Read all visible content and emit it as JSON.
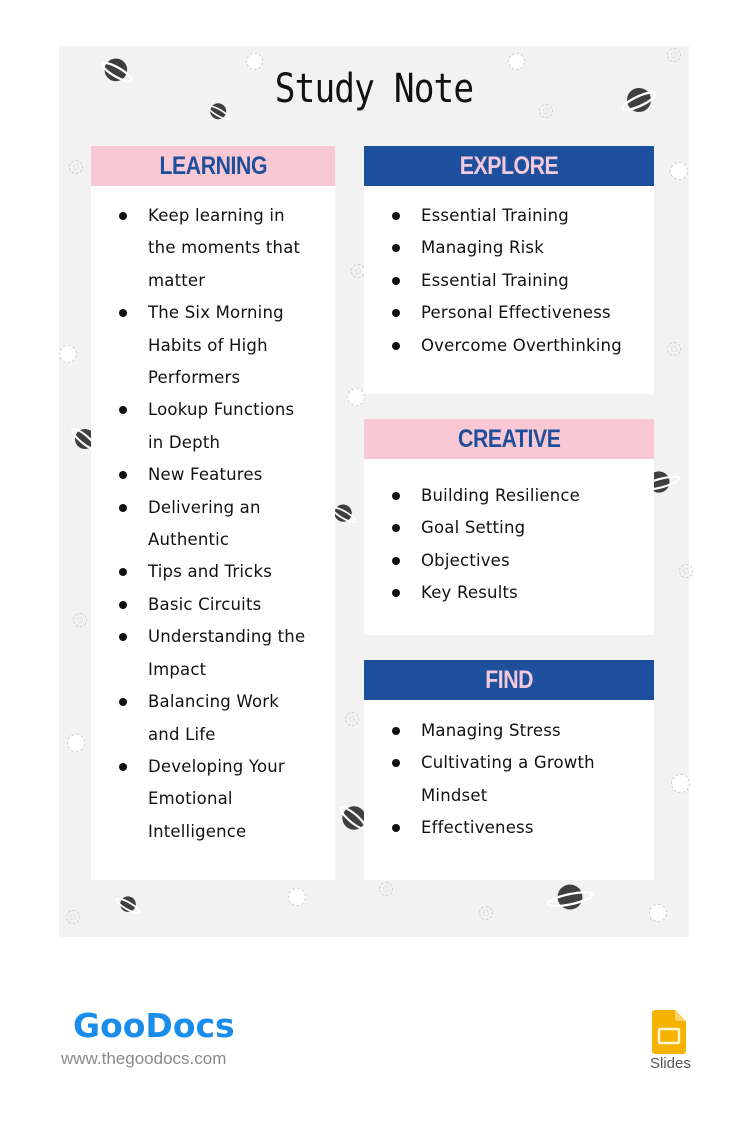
{
  "title": "Study Note",
  "colors": {
    "page_bg": "#f2f2f2",
    "pink": "#f8c8d4",
    "blue": "#1c4f9c",
    "pink_text": "#f4c9dd",
    "blue_text": "#1f4e9b",
    "brand": "#1a8cea"
  },
  "learning": {
    "heading": "LEARNING",
    "items": [
      "Keep learning in the moments that matter",
      "The Six Morning Habits of High Performers",
      "Lookup Functions in Depth",
      "New Features",
      "Delivering an Authentic",
      "Tips and Tricks",
      "Basic Circuits",
      "Understanding the Impact",
      "Balancing Work and Life",
      "Developing Your Emotional Intelligence"
    ]
  },
  "explore": {
    "heading": "EXPLORE",
    "items": [
      "Essential Training",
      "Managing Risk",
      "Essential Training",
      "Personal Effectiveness",
      "Overcome Overthinking"
    ]
  },
  "creative": {
    "heading": "CREATIVE",
    "items": [
      "Building Resilience",
      "Goal Setting",
      "Objectives",
      "Key Results"
    ]
  },
  "find": {
    "heading": "FIND",
    "items": [
      "Managing Stress",
      "Cultivating a Growth Mindset",
      "Effectiveness"
    ]
  },
  "footer": {
    "brand": "GooDocs",
    "url": "www.thegoodocs.com",
    "app_label": "Slides",
    "app_icon": "google-slides-icon"
  }
}
